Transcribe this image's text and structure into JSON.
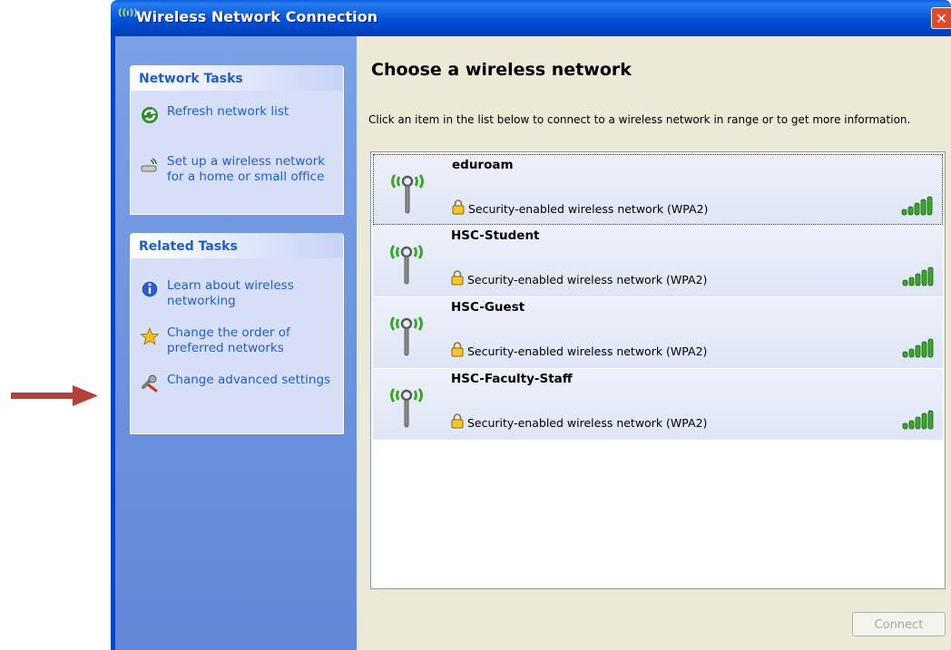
{
  "window": {
    "title": "Wireless Network Connection",
    "title_icon": "wireless-signal-icon",
    "close_label": "✕"
  },
  "sidebar": {
    "network_tasks": {
      "title": "Network Tasks",
      "items": [
        {
          "label": "Refresh network list",
          "icon": "refresh-icon"
        },
        {
          "label": "Set up a wireless network for a home or small office",
          "icon": "setup-wireless-icon"
        }
      ]
    },
    "related_tasks": {
      "title": "Related Tasks",
      "items": [
        {
          "label": "Learn about wireless networking",
          "icon": "info-icon"
        },
        {
          "label": "Change the order of preferred networks",
          "icon": "star-icon"
        },
        {
          "label": "Change advanced settings",
          "icon": "wrench-icon"
        }
      ]
    }
  },
  "main": {
    "heading": "Choose a wireless network",
    "instruction": "Click an item in the list below to connect to a wireless network in range or to get more information.",
    "networks": [
      {
        "name": "eduroam",
        "security": "Security-enabled wireless network (WPA2)",
        "signal_bars": 5,
        "selected": true
      },
      {
        "name": "HSC-Student",
        "security": "Security-enabled wireless network (WPA2)",
        "signal_bars": 5,
        "selected": false
      },
      {
        "name": "HSC-Guest",
        "security": "Security-enabled wireless network (WPA2)",
        "signal_bars": 5,
        "selected": false
      },
      {
        "name": "HSC-Faculty-Staff",
        "security": "Security-enabled wireless network (WPA2)",
        "signal_bars": 5,
        "selected": false
      }
    ],
    "connect_button": "Connect"
  },
  "colors": {
    "task_link": "#215dc6",
    "titlebar": "#0052d6",
    "arrow": "#b5403a",
    "signal": "#3aa62e"
  }
}
